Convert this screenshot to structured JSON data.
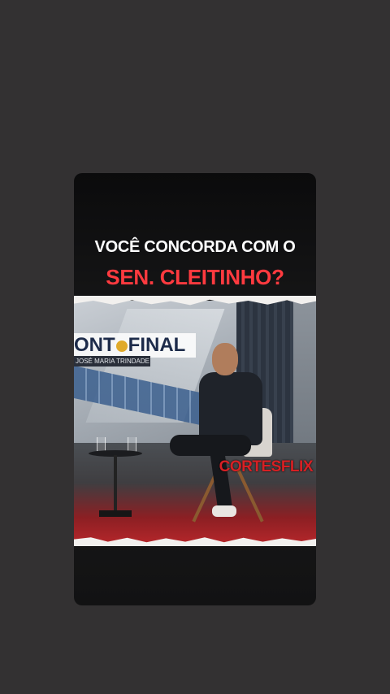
{
  "post": {
    "headline_line1": "VOCÊ CONCORDA COM O",
    "headline_line2": "SEN. CLEITINHO?"
  },
  "video": {
    "show_logo_left": "ONT",
    "show_logo_right": "FINAL",
    "presenter_name": "JOSÉ MARIA TRINDADE",
    "watermark": "CORTESFLIX"
  },
  "colors": {
    "background": "#333132",
    "headline_white": "#ffffff",
    "headline_red": "#ff3a3f",
    "watermark_red": "#d72024",
    "logo_dot": "#e0aa2b"
  }
}
